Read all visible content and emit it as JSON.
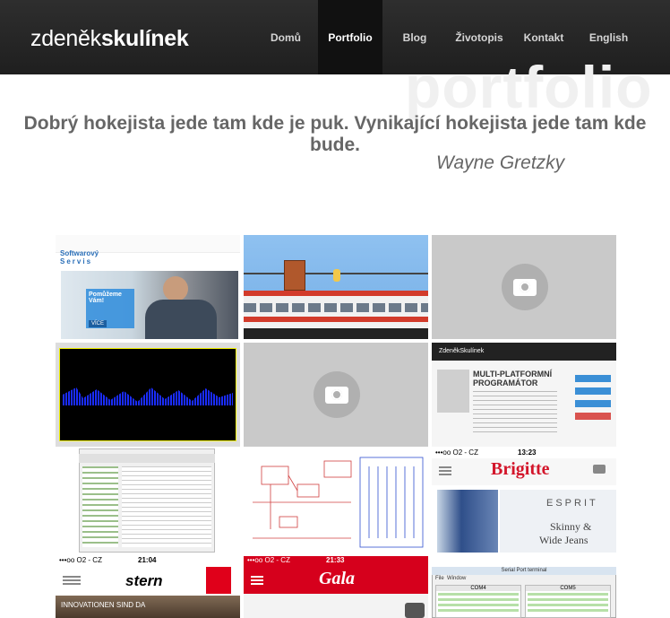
{
  "logo": {
    "first": "zdeněk",
    "last": "skulínek"
  },
  "nav": [
    {
      "label": "Domů",
      "active": false
    },
    {
      "label": "Portfolio",
      "active": true
    },
    {
      "label": "Blog",
      "active": false
    },
    {
      "label": "Životopis",
      "active": false
    },
    {
      "label": "Kontakt",
      "active": false
    },
    {
      "label": "English",
      "active": false
    }
  ],
  "watermark": "portfolio",
  "quote": {
    "text": "Dobrý hokejista jede tam kde je puk. Vynikající hokejista jede tam kde bude.",
    "author": "Wayne Gretzky"
  },
  "tiles": {
    "t1": {
      "brand1": "Softwarový",
      "brand2": "Servis",
      "headline": "Pomůžeme Vám!",
      "btn": "VÍCE"
    },
    "t6": {
      "logo": "ZdeněkSkulínek",
      "heading1": "MULTI-PLATFORMNÍ",
      "heading2": "PROGRAMÁTOR"
    },
    "t9": {
      "carrier": "•••oo O2 - CZ",
      "time": "13:23",
      "brand": "Brigitte",
      "ad1": "ESPRIT",
      "ad2": "Skinny &",
      "ad3": "Wide Jeans"
    },
    "t10": {
      "carrier": "•••oo O2 - CZ",
      "time": "21:04",
      "brand": "stern",
      "banner": "INNOVATIONEN SIND DA"
    },
    "t11": {
      "carrier": "•••oo O2 - CZ",
      "time": "21:33",
      "brand": "Gala"
    },
    "t12": {
      "title": "Serial Port terminal",
      "menu1": "File",
      "menu2": "Window",
      "com1": "COM4",
      "com2": "COM5"
    }
  }
}
